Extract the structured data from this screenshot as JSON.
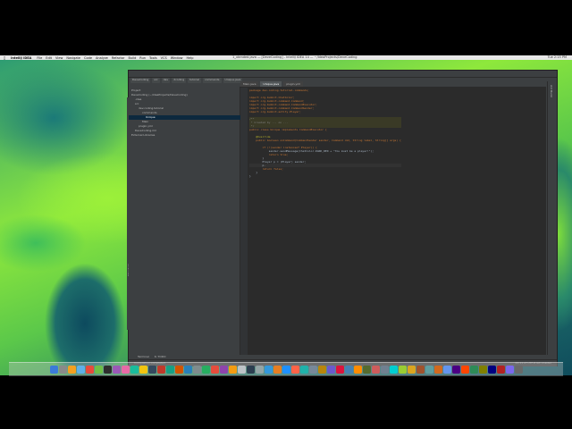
{
  "window_title": "1_xtended.java — [DeveCoding] - IntelliJ IDEA 14 — ~/IdeaProjects/DeveCoding",
  "menubar": {
    "app": "IntelliJ IDEA",
    "items": [
      "File",
      "Edit",
      "View",
      "Navigate",
      "Code",
      "Analyze",
      "Refactor",
      "Build",
      "Run",
      "Tools",
      "VCS",
      "Window",
      "Help"
    ],
    "right": "Tue 2:15 PM"
  },
  "breadcrumbs": [
    "DeveCoding",
    "src",
    "dev",
    "dcoding",
    "tutorial",
    "commands",
    "Unique.java"
  ],
  "project_tree": [
    {
      "label": "Project",
      "indent": 0
    },
    {
      "label": "DeveCoding  (~/IdeaProjects/DeveCoding)",
      "indent": 0
    },
    {
      "label": ".idea",
      "indent": 1
    },
    {
      "label": "src",
      "indent": 1
    },
    {
      "label": "dev.coding.tutorial",
      "indent": 2
    },
    {
      "label": "commands",
      "indent": 3
    },
    {
      "label": "Unique",
      "indent": 4,
      "selected": true
    },
    {
      "label": "Main",
      "indent": 3
    },
    {
      "label": "plugin.yml",
      "indent": 2
    },
    {
      "label": "DeveCoding.iml",
      "indent": 1
    },
    {
      "label": "External Libraries",
      "indent": 0
    }
  ],
  "editor_tabs": [
    {
      "label": "Main.java",
      "active": false
    },
    {
      "label": "Unique.java",
      "active": true
    },
    {
      "label": "plugin.yml",
      "active": false
    }
  ],
  "code_lines": [
    "package dev.coding.tutorial.commands;",
    "",
    "import org.bukkit.ChatColor;",
    "import org.bukkit.command.Command;",
    "import org.bukkit.command.CommandExecutor;",
    "import org.bukkit.command.CommandSender;",
    "import org.bukkit.entity.Player;",
    "",
    "/**",
    " * Created by ... on ...",
    " */",
    "public class Unique implements CommandExecutor {",
    "",
    "    @Override",
    "    public boolean onCommand(CommandSender sender, Command cmd, String label, String[] args) {",
    "",
    "        if (!(sender instanceof Player)) {",
    "            sender.sendMessage(ChatColor.DARK_RED + \"You must be a player!\");",
    "            return true;",
    "        }",
    "        Player p = (Player) sender;",
    "        p.",
    "        return false;",
    "    }",
    "}"
  ],
  "bottom_tabs": [
    "Terminal",
    "6: TODO"
  ],
  "status": {
    "left": "Compilation completed",
    "right": "22:11  LF  UTF-8  Git: master"
  },
  "left_strip_label": "Structure",
  "right_strip_label": "Ant Build"
}
